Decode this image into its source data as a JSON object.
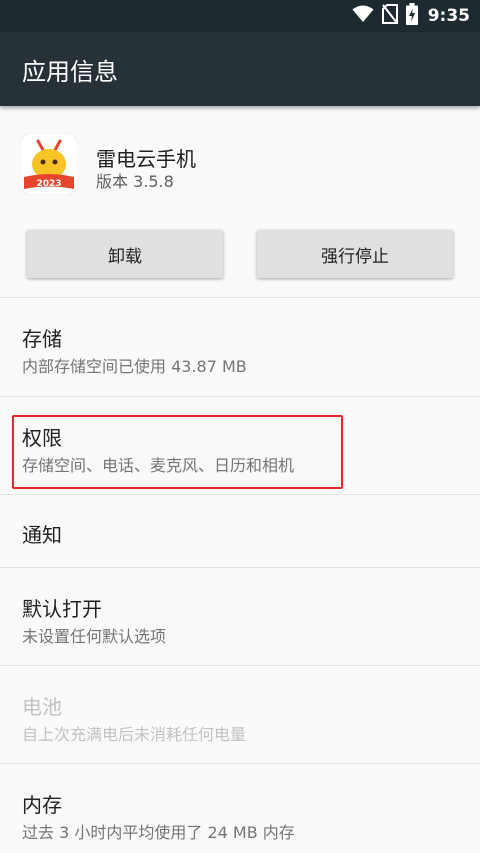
{
  "status_bar": {
    "time": "9:35",
    "icons": [
      "wifi-icon",
      "no-sim-icon",
      "battery-charging-icon"
    ]
  },
  "app_bar": {
    "title": "应用信息"
  },
  "app": {
    "name": "雷电云手机",
    "version": "版本 3.5.8",
    "icon_badge": "2023",
    "icon_colors": {
      "background": "#ffffff",
      "character": "#f7c325",
      "banner": "#e8452e"
    }
  },
  "buttons": {
    "uninstall": "卸载",
    "force_stop": "强行停止"
  },
  "settings": {
    "storage": {
      "title": "存储",
      "subtitle": "内部存储空间已使用 43.87 MB"
    },
    "permissions": {
      "title": "权限",
      "subtitle": "存储空间、电话、麦克风、日历和相机"
    },
    "notifications": {
      "title": "通知"
    },
    "open_by_default": {
      "title": "默认打开",
      "subtitle": "未设置任何默认选项"
    },
    "battery": {
      "title": "电池",
      "subtitle": "自上次充满电后未消耗任何电量",
      "enabled": false
    },
    "memory": {
      "title": "内存",
      "subtitle": "过去 3 小时内平均使用了 24 MB 内存"
    }
  },
  "colors": {
    "status_bar": "#1d2a30",
    "app_bar": "#263238",
    "background": "#fafafa",
    "highlight": "#e8262a"
  }
}
